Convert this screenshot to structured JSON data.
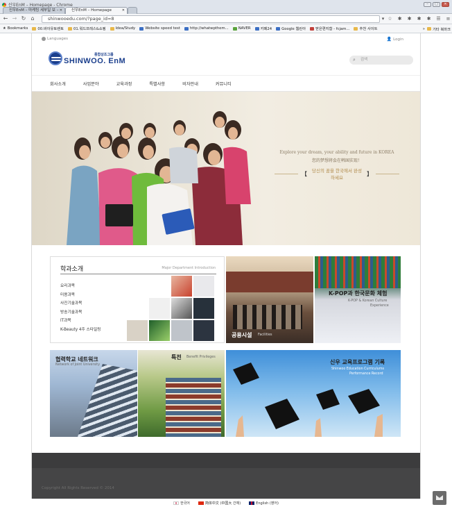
{
  "window": {
    "title": "신우EnM – Homepage - Chrome",
    "controls": [
      "–",
      "□",
      "✕"
    ]
  },
  "tabs": [
    {
      "label": "신우EnM – 마케팅 세부일 보 –",
      "active": false
    },
    {
      "label": "신우EnM – Homepage",
      "active": true
    }
  ],
  "address_bar": {
    "url": "shinwooedu.com/?page_id=8"
  },
  "bookmarks": [
    {
      "label": "Bookmarks",
      "icon": "star-icon"
    },
    {
      "label": "00.바이유토렌토",
      "icon": "folder-icon"
    },
    {
      "label": "01.워드프레스&쇼핑",
      "icon": "folder-icon"
    },
    {
      "label": "Idea/Study",
      "icon": "folder-icon"
    },
    {
      "label": "Website speed test",
      "icon": "page-icon"
    },
    {
      "label": "http://whatwpthem...",
      "icon": "page-icon"
    },
    {
      "label": "NAVER",
      "icon": "naver-icon"
    },
    {
      "label": "카페24",
      "icon": "page-icon"
    },
    {
      "label": "Google 웹린아",
      "icon": "google-icon"
    },
    {
      "label": "받은편지함 - fcjam...",
      "icon": "gmail-icon"
    },
    {
      "label": "추천 사이트",
      "icon": "page-icon"
    }
  ],
  "bookmarks_overflow": "»",
  "bookmarks_other": "기타 북마크",
  "site": {
    "languages_label": "Languages",
    "login_label": "Login",
    "logo_sub": "종합상조그룹",
    "logo_main": "SHINWOO. EnM",
    "search_placeholder": "검색",
    "menu": [
      "회사소개",
      "사업분야",
      "교육과정",
      "특별사항",
      "비자안내",
      "커뮤니티"
    ],
    "hero": {
      "line1": "Explore your dream, your ability and future in KOREA",
      "line2": "您的梦想将会在韩国实现！",
      "line3": "당신의 꿈을 한국에서 완성하세요"
    },
    "dept": {
      "title": "학과소개",
      "eng": "Major Department Introduction",
      "items": [
        "요리과목",
        "미용과목",
        "사진기술과목",
        "방송기술과목",
        "IT과목",
        "K-Beauty 4주 스타일링"
      ]
    },
    "facility": {
      "title": "공용시설",
      "sub": "Facilities"
    },
    "kpop": {
      "title": "K-POP과 한국문화 체험",
      "sub1": "K-POP & Korean Culture",
      "sub2": "Experience"
    },
    "network": {
      "title": "협력학교 네트워크",
      "sub": "Network of Joint University"
    },
    "special": {
      "title": "특전",
      "sub": "Benefit Privileges"
    },
    "edu": {
      "title": "신우 교육프로그램 기록",
      "sub1": "Shinwoo Education Curriculums",
      "sub2": "Performance Record"
    },
    "footer_copyright": "Copyright All Rights Reserved © 2014",
    "langs": [
      {
        "label": "한국어",
        "colors": [
          "#ffffff",
          "#c60c30"
        ]
      },
      {
        "label": "简体中文 (中国大 간체)",
        "colors": [
          "#de2910",
          "#ffde00"
        ]
      },
      {
        "label": "English (영어)",
        "colors": [
          "#012169",
          "#c8102e"
        ]
      }
    ]
  },
  "colors": {
    "brand": "#1a3e8c",
    "footer": "#454546"
  }
}
